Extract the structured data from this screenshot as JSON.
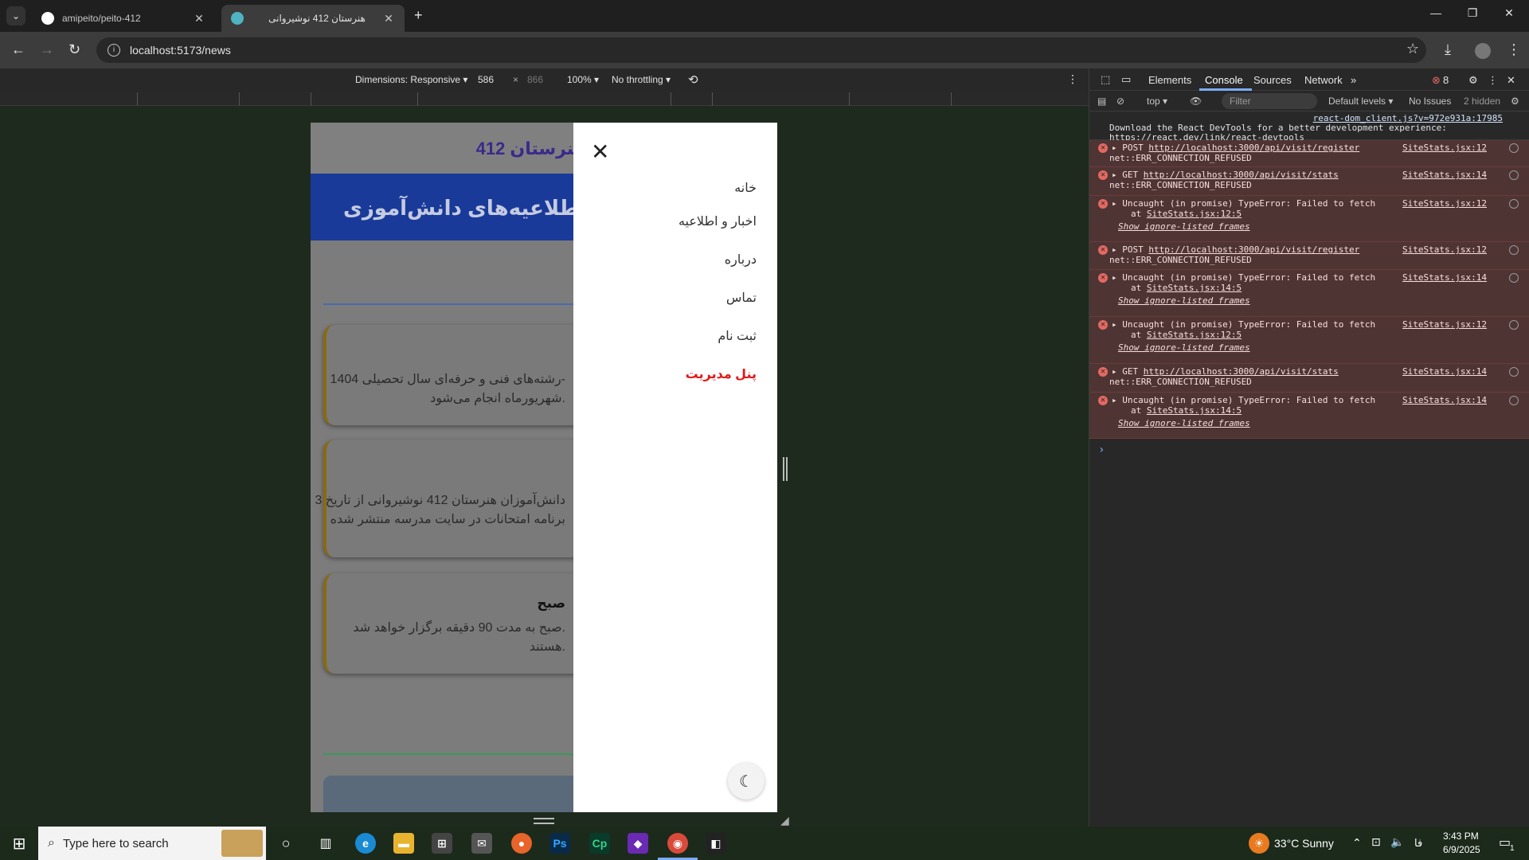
{
  "browser": {
    "tabs": [
      {
        "title": "amipeito/peito-412"
      },
      {
        "title": "هنرستان 412 نوشیروانی"
      }
    ],
    "new_tab": "+",
    "url": "localhost:5173/news"
  },
  "device_toolbar": {
    "dimensions_label": "Dimensions: Responsive ▾",
    "width": "586",
    "times": "×",
    "height": "866",
    "zoom": "100% ▾",
    "throttling": "No throttling ▾"
  },
  "page": {
    "brand": "هنرستان 412",
    "banner": "اطلاعیه‌های دانش‌آموزی",
    "card1_line1": "رشته‌های فنی و حرفه‌ای سال تحصیلی 1404-",
    "card1_line2": "شهریورماه انجام می‌شود.",
    "card2_line1": "دانش‌آموزان هنرستان 412 نوشیروانی از تاریخ 3",
    "card2_line2": "برنامه امتحانات در سایت مدرسه منتشر شده",
    "card3_title": "صبح",
    "card3_line1": "صبح به مدت 90 دقیقه برگزار خواهد شد.",
    "card3_line2": "هستند."
  },
  "drawer": {
    "items": [
      {
        "label": "خانه"
      },
      {
        "label": "اخبار و اطلاعیه"
      },
      {
        "label": "درباره"
      },
      {
        "label": "تماس"
      },
      {
        "label": "ثبت نام"
      },
      {
        "label": "پنل مدیریت"
      }
    ]
  },
  "devtools": {
    "tabs": [
      "Elements",
      "Console",
      "Sources",
      "Network"
    ],
    "active_tab": "Console",
    "error_count": "8",
    "context": "top ▾",
    "filter_placeholder": "Filter",
    "levels": "Default levels ▾",
    "issues": "No Issues",
    "hidden": "2 hidden",
    "messages": [
      {
        "type": "info",
        "source": "react-dom_client.js?v=972e931a:17985",
        "line1": "Download the React DevTools for a better development experience:",
        "line2": "https://react.dev/link/react-devtools"
      },
      {
        "type": "error",
        "method": "POST",
        "url": "http://localhost:3000/api/visit/register",
        "source": "SiteStats.jsx:12",
        "line2": "net::ERR_CONNECTION_REFUSED"
      },
      {
        "type": "error",
        "method": "GET",
        "url": "http://localhost:3000/api/visit/stats",
        "source": "SiteStats.jsx:14",
        "line2": "net::ERR_CONNECTION_REFUSED"
      },
      {
        "type": "error",
        "text": "Uncaught (in promise) TypeError: Failed to fetch",
        "source": "SiteStats.jsx:12",
        "at": "SiteStats.jsx:12:5",
        "ignored": "Show ignore-listed frames"
      },
      {
        "type": "error",
        "method": "POST",
        "url": "http://localhost:3000/api/visit/register",
        "source": "SiteStats.jsx:12",
        "line2": "net::ERR_CONNECTION_REFUSED"
      },
      {
        "type": "error",
        "text": "Uncaught (in promise) TypeError: Failed to fetch",
        "source": "SiteStats.jsx:14",
        "at": "SiteStats.jsx:14:5",
        "ignored": "Show ignore-listed frames"
      },
      {
        "type": "error",
        "text": "Uncaught (in promise) TypeError: Failed to fetch",
        "source": "SiteStats.jsx:12",
        "at": "SiteStats.jsx:12:5",
        "ignored": "Show ignore-listed frames"
      },
      {
        "type": "error",
        "method": "GET",
        "url": "http://localhost:3000/api/visit/stats",
        "source": "SiteStats.jsx:14",
        "line2": "net::ERR_CONNECTION_REFUSED"
      },
      {
        "type": "error",
        "text": "Uncaught (in promise) TypeError: Failed to fetch",
        "source": "SiteStats.jsx:14",
        "at": "SiteStats.jsx:14:5",
        "ignored": "Show ignore-listed frames"
      }
    ],
    "at_prefix": "at"
  },
  "taskbar": {
    "search_placeholder": "Type here to search",
    "weather": "33°C  Sunny",
    "language": "فا",
    "time": "3:43 PM",
    "date": "6/9/2025",
    "notif_count": "1"
  },
  "colors": {
    "banner_bg": "#1a3a9a",
    "menu_admin": "#e01b1b",
    "error_bg": "#4e3534",
    "accent_tab": "#7cacf8"
  }
}
